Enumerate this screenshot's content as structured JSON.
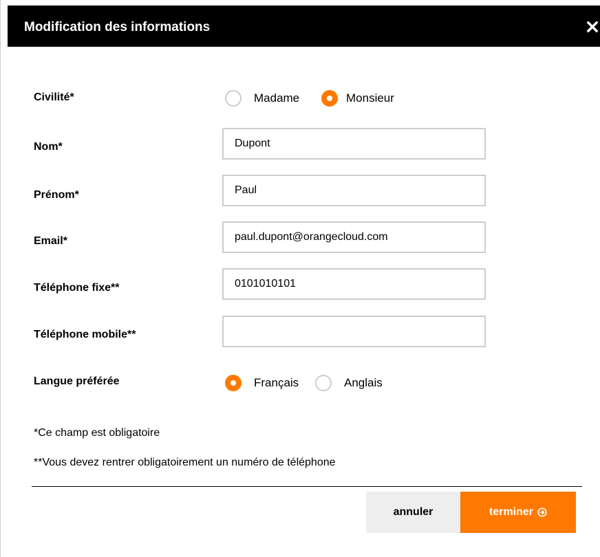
{
  "modal": {
    "title": "Modification des informations",
    "close_icon": "close-icon"
  },
  "form": {
    "civilite": {
      "label": "Civilité*",
      "options": [
        {
          "label": "Madame",
          "checked": false
        },
        {
          "label": "Monsieur",
          "checked": true
        }
      ]
    },
    "nom": {
      "label": "Nom*",
      "value": "Dupont"
    },
    "prenom": {
      "label": "Prénom*",
      "value": "Paul"
    },
    "email": {
      "label": "Email*",
      "value": "paul.dupont@orangecloud.com"
    },
    "telephone_fixe": {
      "label": "Téléphone fixe**",
      "value": "0101010101"
    },
    "telephone_mobile": {
      "label": "Téléphone mobile**",
      "value": ""
    },
    "langue": {
      "label": "Langue préférée",
      "options": [
        {
          "label": "Français",
          "checked": true
        },
        {
          "label": "Anglais",
          "checked": false
        }
      ]
    }
  },
  "notes": {
    "required": "*Ce champ est obligatoire",
    "phone_required": "**Vous devez rentrer obligatoirement un numéro de téléphone"
  },
  "actions": {
    "cancel_label": "annuler",
    "finish_label": "terminer",
    "finish_icon": "arrow-circle-right-icon"
  },
  "colors": {
    "accent": "#ff7900",
    "header_bg": "#000000",
    "cancel_bg": "#eeeeee",
    "input_border": "#cccccc"
  }
}
